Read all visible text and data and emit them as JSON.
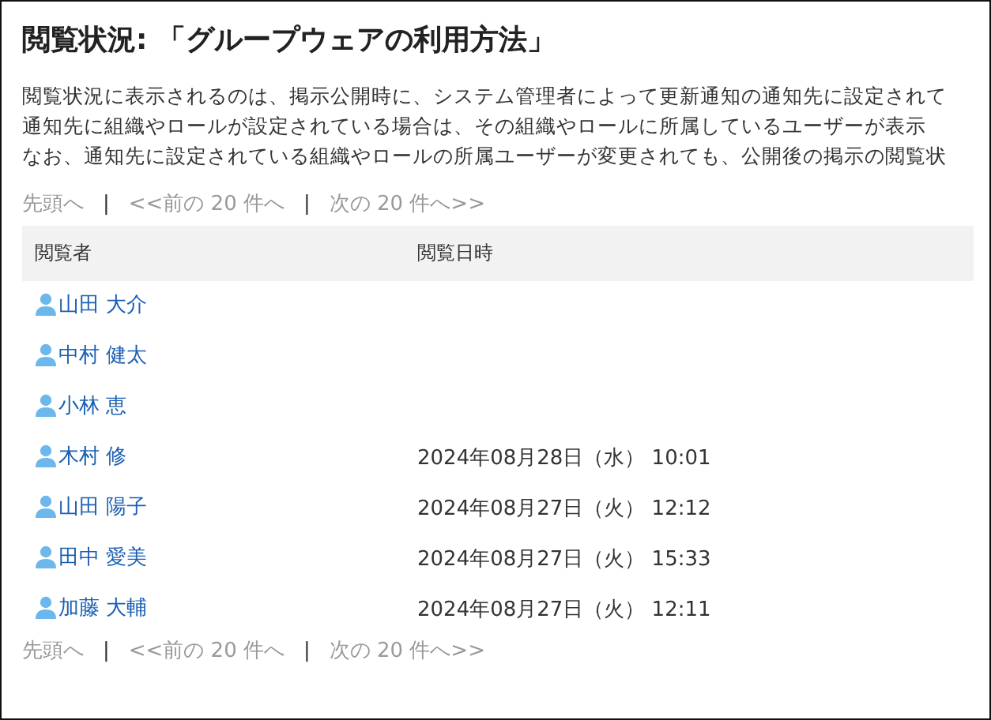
{
  "title": "閲覧状況: 「グループウェアの利用方法」",
  "description": [
    "閲覧状況に表示されるのは、掲示公開時に、システム管理者によって更新通知の通知先に設定されて",
    "通知先に組織やロールが設定されている場合は、その組織やロールに所属しているユーザーが表示",
    "なお、通知先に設定されている組織やロールの所属ユーザーが変更されても、公開後の掲示の閲覧状"
  ],
  "pagination_top": [
    {
      "label": "先頭へ",
      "disabled": true
    },
    {
      "label": "<<前の 20 件へ",
      "disabled": true
    },
    {
      "label": "次の 20 件へ>>",
      "disabled": true
    }
  ],
  "table": {
    "columns": [
      "閲覧者",
      "閲覧日時"
    ],
    "rows": [
      {
        "viewer": "山田 大介"
      },
      {
        "viewer": "中村 健太"
      },
      {
        "viewer": "小林 恵"
      },
      {
        "viewer": "木村 修",
        "datetime": "2024年08月28日（水） 10:01"
      },
      {
        "viewer": "山田 陽子",
        "datetime": "2024年08月27日（火） 12:12"
      },
      {
        "viewer": "田中 愛美",
        "datetime": "2024年08月27日（火） 15:33"
      },
      {
        "viewer": "加藤 大輔",
        "datetime": "2024年08月27日（火） 12:11"
      }
    ]
  },
  "pagination_bottom": [
    {
      "label": "先頭へ",
      "disabled": true
    },
    {
      "label": "<<前の 20 件へ",
      "disabled": true
    },
    {
      "label": "次の 20 件へ>>",
      "disabled": true
    }
  ],
  "separator": "|"
}
